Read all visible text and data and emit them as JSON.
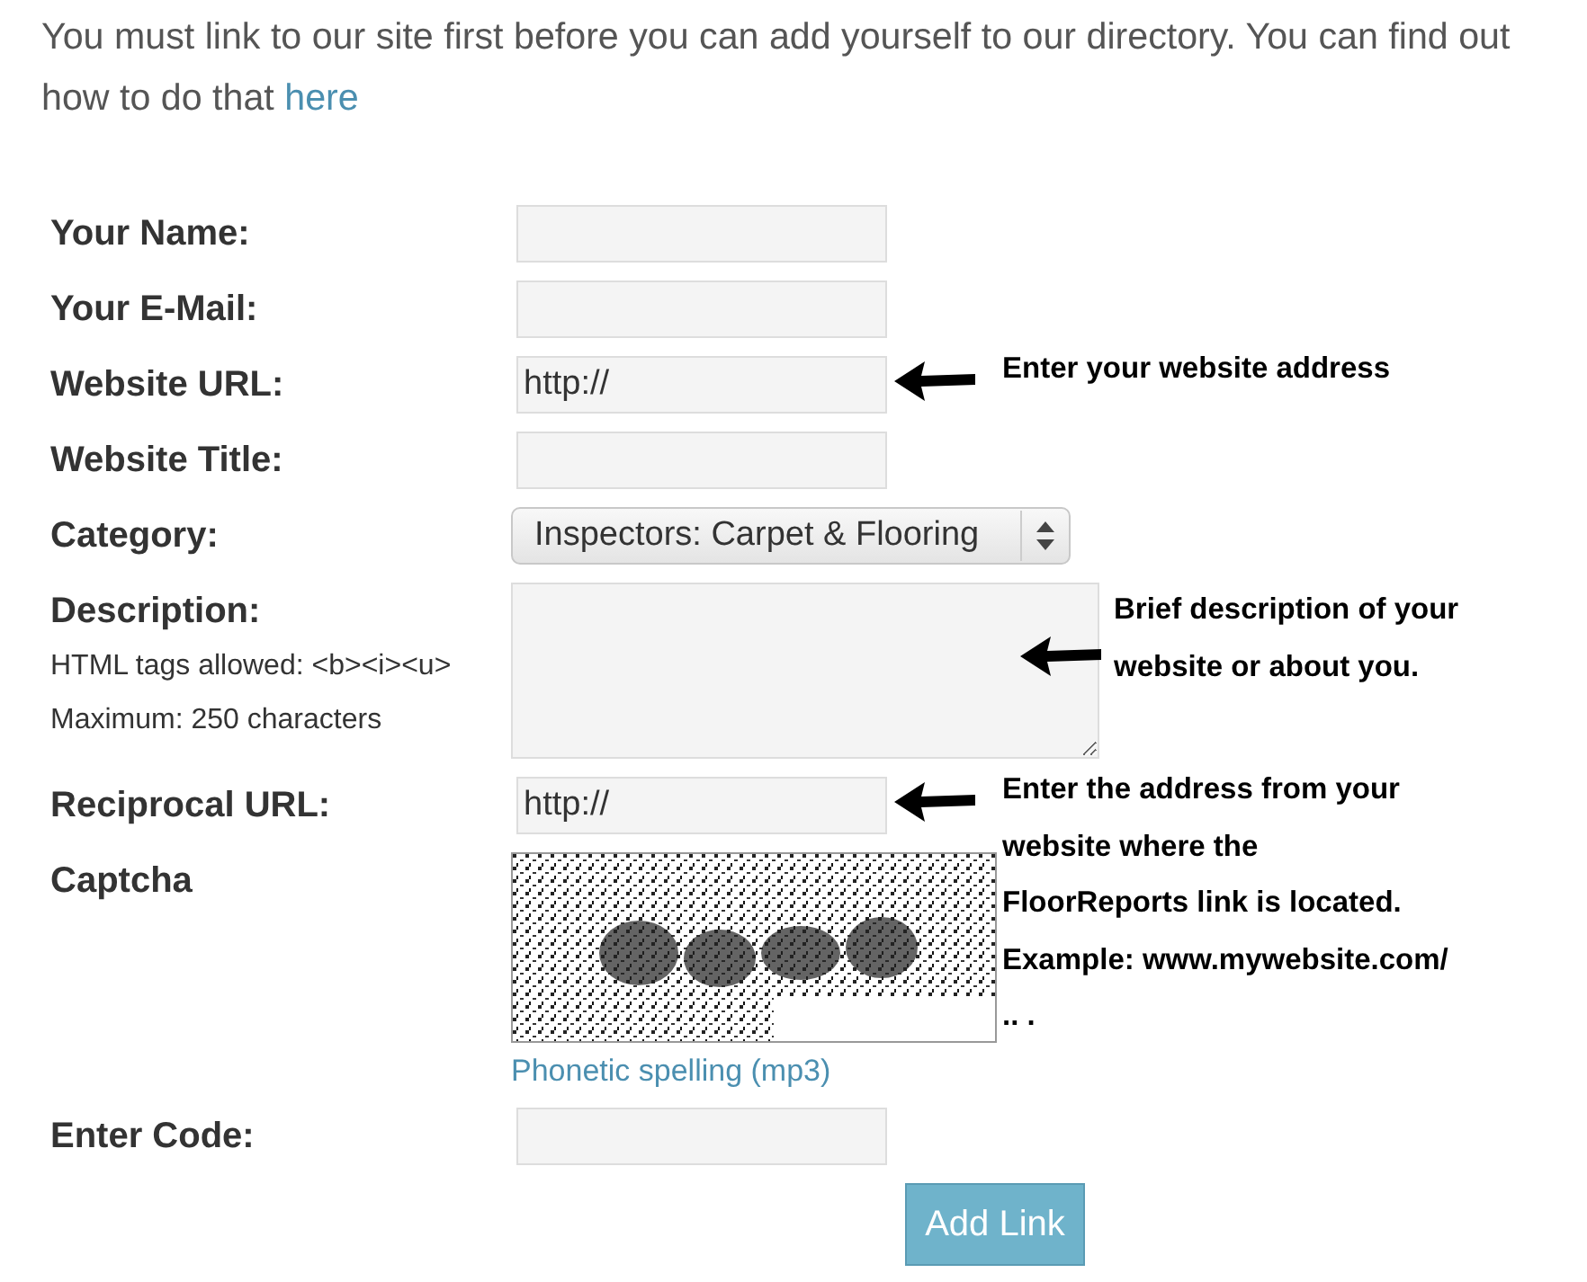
{
  "intro": {
    "text": "You must link to our site first before you can add yourself to our directory. You can find out how to do that ",
    "link": "here"
  },
  "fields": [
    {
      "kind": "text",
      "label": "Your Name:"
    },
    {
      "kind": "text",
      "label": "Your E-Mail:"
    },
    {
      "kind": "text",
      "label": "Website URL:",
      "value": "http://",
      "note": [
        "Enter your website address"
      ]
    },
    {
      "kind": "text",
      "label": "Website Title:"
    },
    {
      "kind": "select",
      "label": "Category:",
      "value": "Inspectors: Carpet & Flooring"
    },
    {
      "kind": "textarea",
      "label": "Description:",
      "hints": [
        "HTML tags allowed: <b><i><u>",
        "Maximum: 250 characters"
      ],
      "note": [
        "Brief description of your",
        "website or about you."
      ]
    },
    {
      "kind": "text",
      "label": "Reciprocal URL:",
      "value": "http://",
      "note": [
        "Enter the address from your",
        "website where the",
        "FloorReports link is located.",
        "Example: www.mywebsite.com/",
        "..  ."
      ]
    },
    {
      "kind": "captcha",
      "label": "Captcha",
      "link": "Phonetic spelling (mp3)"
    },
    {
      "kind": "text",
      "label": "Enter Code:"
    }
  ],
  "submit": "Add Link"
}
